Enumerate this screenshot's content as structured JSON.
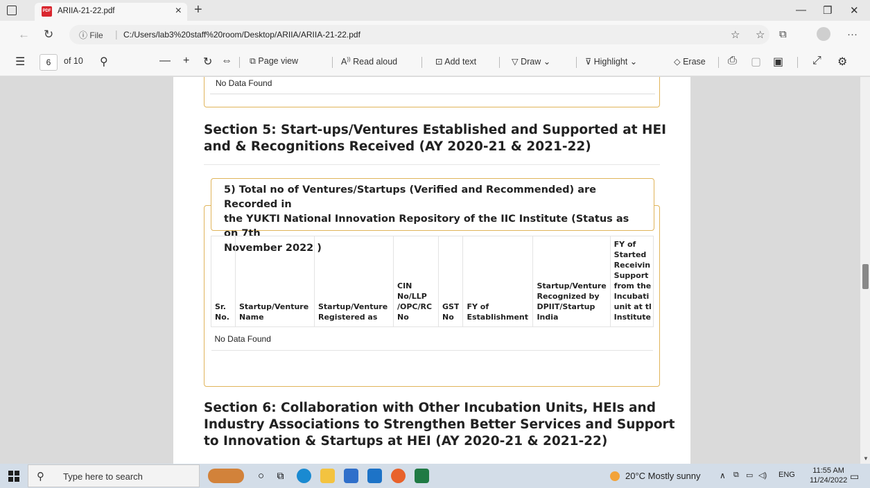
{
  "browser": {
    "tab_title": "ARIIA-21-22.pdf",
    "tab_close": "×",
    "new_tab": "+",
    "url_prefix": "File",
    "url": "C:/Users/lab3%20staff%20room/Desktop/ARIIA/ARIIA-21-22.pdf",
    "favicon_text": "PDF"
  },
  "pdf_toolbar": {
    "page_number": "6",
    "page_total": "of 10",
    "page_view": "Page view",
    "read_aloud": "Read aloud",
    "add_text": "Add text",
    "draw": "Draw",
    "highlight": "Highlight",
    "erase": "Erase"
  },
  "document": {
    "prev_box_text": "No Data Found",
    "section5_title_line1": "Section 5: Start-ups/Ventures Established and Supported at HEI",
    "section5_title_line2": "and & Recognitions Received (AY 2020-21 & 2021-22)",
    "box_heading_line1": "5) Total no of Ventures/Startups (Verified and Recommended) are Recorded in",
    "box_heading_line2": "the YUKTI National Innovation Repository of the IIC Institute (Status as on 7th",
    "box_heading_line3": "November 2022 )",
    "table": {
      "headers": [
        [
          "Sr.",
          "No."
        ],
        [
          "Startup/Venture",
          "Name"
        ],
        [
          "Startup/Venture",
          "Registered as"
        ],
        [
          "CIN",
          "No/LLP",
          "/OPC/RC",
          "No"
        ],
        [
          "GST",
          "No"
        ],
        [
          "FY of",
          "Establishment"
        ],
        [
          "Startup/Venture",
          "Recognized by",
          "DPIIT/Startup",
          "India"
        ],
        [
          "FY of",
          "Started",
          "Receivin",
          "Support",
          "from the",
          "Incubati",
          "unit at tl",
          "Institute"
        ]
      ],
      "empty_text": "No Data Found"
    },
    "section6_title_line1": "Section 6: Collaboration with Other Incubation Units, HEIs and",
    "section6_title_line2": "Industry Associations to Strengthen Better Services and Support",
    "section6_title_line3": "to Innovation & Startups at HEI (AY 2020-21 & 2021-22)"
  },
  "taskbar": {
    "search_placeholder": "Type here to search",
    "weather": "20°C  Mostly sunny",
    "language": "ENG",
    "time": "11:55 AM",
    "date": "11/24/2022"
  }
}
